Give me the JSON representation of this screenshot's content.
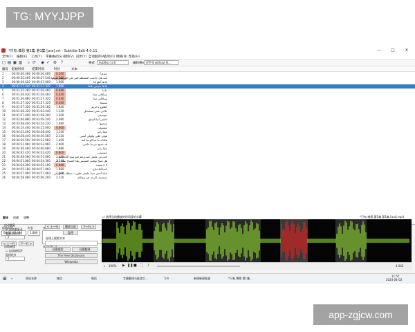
{
  "watermarks": {
    "top_left": "TG: MYYJJPP",
    "bottom_right": "app-zgjcw.com"
  },
  "window": {
    "title": "*只有.博恩 第1集 第1集 [ara].srt - Subtitle Edit 4.0.11"
  },
  "menu": [
    "文件(F)",
    "编辑(E)",
    "工具(T)",
    "字幕格式(S)",
    "视频(V)",
    "同步(Y)",
    "自动翻译(A)",
    "选项(O)",
    "网络(N)",
    "帮助(H)"
  ],
  "toolbar": {
    "format_label": "格式",
    "format_value": "SubRip (.srt)",
    "encoding_label": "编码格式",
    "encoding_value": "UTF-8 without B..."
  },
  "grid": {
    "columns": [
      "编号",
      "起始时间",
      "结束时间",
      "时长",
      "文本"
    ],
    "rows": [
      {
        "n": "1",
        "start": "00:00:30.466",
        "end": "00:00:30.466",
        "dur": "0.200",
        "text": "جيدي!",
        "hl": true
      },
      {
        "n": "2",
        "start": "00:00:35.466",
        "end": "00:00:37.546",
        "dur": "1.560",
        "text": "أنت هل حاجيت المشكلة التي هي المريضة تعملها",
        "hl": true
      },
      {
        "n": "3",
        "start": "00:00:36.620",
        "end": "00:00:37.600",
        "dur": "1.960",
        "text": "بلاظ أقلغ ليا",
        "hl": false
      },
      {
        "n": "4",
        "start": "00:01:17.440",
        "end": "00:01:22.320",
        "dur": "1.880",
        "text": "بلاظ حبيبتي بلاظ",
        "sel": true
      },
      {
        "n": "5",
        "start": "00:01:25.260",
        "end": "00:01:26.460",
        "dur": "0.480",
        "text": "ماما",
        "hl": true
      },
      {
        "n": "6",
        "start": "00:01:26.020",
        "end": "00:01:26.460",
        "dur": "0.440",
        "text": "يساقاني معا",
        "hl": true
      },
      {
        "n": "7",
        "start": "00:01:26.880",
        "end": "00:01:27.320",
        "dur": "0.440",
        "text": "يساقاني معا",
        "hl": true
      },
      {
        "n": "8",
        "start": "00:01:27.320",
        "end": "00:01:27.320",
        "dur": "0.400",
        "text": "تسسلا",
        "hl": true
      },
      {
        "n": "9",
        "start": "00:01:37.320",
        "end": "00:01:39.160",
        "dur": "1.840",
        "text": "أطلوع يا كريم",
        "hl": false
      },
      {
        "n": "10",
        "start": "00:01:38.320",
        "end": "00:01:42.440",
        "dur": "1.120",
        "text": "ماكين شئي سشحاق",
        "hl": false
      },
      {
        "n": "11",
        "start": "00:01:57.000",
        "end": "00:01:58.200",
        "dur": "1.200",
        "text": "موسيقى",
        "hl": false
      },
      {
        "n": "12",
        "start": "00:03:46.880",
        "end": "00:03:49.240",
        "dur": "2.080",
        "text": "اخلص أنيا الصاي",
        "hl": false
      },
      {
        "n": "13",
        "start": "00:03:48.400",
        "end": "00:03:54.220",
        "dur": "1.480",
        "text": "شحيتها",
        "hl": false
      },
      {
        "n": "14",
        "start": "00:04:14.400",
        "end": "00:04:15.000",
        "dur": "0.600",
        "text": "موسيقى",
        "hl": true
      },
      {
        "n": "15",
        "start": "00:04:23.260",
        "end": "00:04:28.440",
        "dur": "1.140",
        "text": "علبا راني",
        "hl": false
      },
      {
        "n": "16",
        "start": "00:04:28.440",
        "end": "00:04:30.560",
        "dur": "2.120",
        "text": "قولي قلبي وقولي أسيي",
        "hl": false
      },
      {
        "n": "17",
        "start": "00:04:30.560",
        "end": "00:04:31.960",
        "dur": "1.400",
        "text": "هكذاه ما تعا الوجيا آسا",
        "hl": false
      },
      {
        "n": "18",
        "start": "00:04:31.960",
        "end": "00:04:33.960",
        "dur": "2.000",
        "text": "قد نصبح مرحبا ماشي",
        "hl": false
      },
      {
        "n": "19",
        "start": "00:04:36.460",
        "end": "00:04:40.680",
        "dur": "1.880",
        "text": "علبا راني",
        "hl": false
      },
      {
        "n": "20",
        "start": "00:04:42.420",
        "end": "00:04:43.420",
        "dur": "0.800",
        "text": "موسيقى",
        "hl": true
      },
      {
        "n": "21",
        "start": "00:04:48.580",
        "end": "00:04:51.060",
        "dur": "2.480",
        "text": "البعرض عليش تصديرهم فيو بيوم الكحصيين",
        "hl": false
      },
      {
        "n": "22",
        "start": "00:04:51.860",
        "end": "00:04:54.360",
        "dur": "3.240",
        "text": "هل نسخ توقيت الميمس هذا الصباح صاية راني",
        "hl": false
      },
      {
        "n": "23",
        "start": "00:04:54.300",
        "end": "00:04:55.180",
        "dur": "0.680",
        "text": "لا لا سيدة",
        "hl": true
      },
      {
        "n": "24",
        "start": "00:04:55.180",
        "end": "00:04:57.060",
        "dur": "1.880",
        "text": "أسبا أقاسياح",
        "hl": false
      },
      {
        "n": "25",
        "start": "00:04:57.060",
        "end": "00:04:57.060",
        "dur": "2.060",
        "text": "انياة أمس مغبا عليش تطورت ضطلة بالتغويبني",
        "hl": false
      },
      {
        "n": "26",
        "start": "00:04:58.080",
        "end": "00:05:00.200",
        "dur": "2.120",
        "text": "تستحيف الرحة في ييمكلم",
        "hl": false
      }
    ]
  },
  "editor": {
    "start_label": "起始时间",
    "start_value": "00:01:17.440",
    "dur_label": "时长",
    "dur_value": "1.880",
    "text_label": "文本",
    "text_value": "بلاظ حبيبتي بلاظ",
    "chars_label": "字符/秒: 8.51",
    "total_label": "单行长度: 16",
    "sub_len_label": "单行长度: 16",
    "prev_button": "< 上一行",
    "next_button": "下一行 >",
    "unbreak_button": "自动断行",
    "break_button": "取消断行"
  },
  "tabs": [
    "翻译",
    "创建",
    "调整"
  ],
  "translate": {
    "auto_repeat": "自动重复",
    "auto_repeat_on": "☑ 自动重复开",
    "repeat_count": "重复次数(次)",
    "repeat_value": "2",
    "auto_continue": "自动继续",
    "auto_continue_on": "☐ 自动继续开",
    "delay": "延时(秒)",
    "delay_value": "2",
    "prev": "< 上一行",
    "play": "播放当前",
    "next": "下一行 >",
    "pause": "暂停",
    "search_label": "在网上搜索文本",
    "google_it": "谷歌搜索",
    "google_translate": "谷歌翻译",
    "free_dictionary": "The Free Dictionary",
    "wikipedia": "Wikipedia"
  },
  "waveform": {
    "checkbox": "☐ 选择当前播放的时间段的字幕",
    "file": "*只有.博恩 第1集 第1集 [ara].mp4",
    "zoom": "100%",
    "time": "4.042"
  },
  "taskbar": {
    "items": [
      "网站名称",
      "微信",
      "微信",
      "字幕翻译与批改工...",
      "飞书",
      "新规新规批量",
      "*只有.博恩 第1集..."
    ],
    "clock": "11:57",
    "date": "2024-04-02"
  },
  "colors": {
    "selection": "#3779c9",
    "duration_highlight": "#f2b9a9",
    "wave_green": "#8fd630",
    "wave_red": "#e02020"
  }
}
